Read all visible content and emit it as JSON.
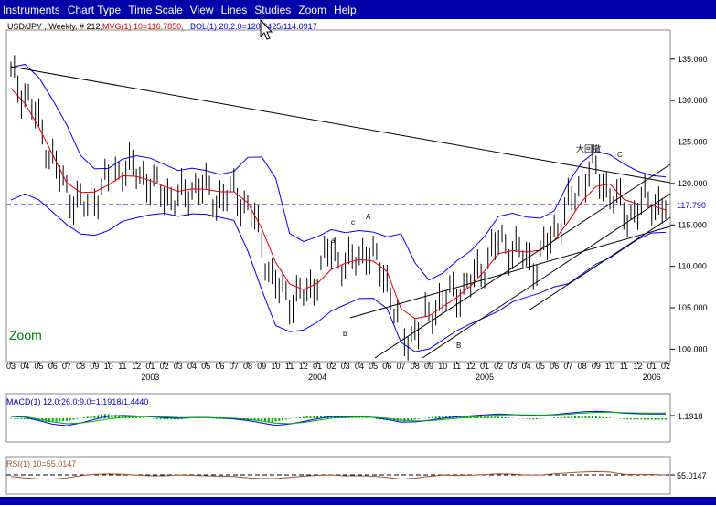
{
  "menu": [
    "Instruments",
    "Chart Type",
    "Time Scale",
    "View",
    "Lines",
    "Studies",
    "Zoom",
    "Help"
  ],
  "colors": {
    "menu_bg": "#0000a8",
    "price": "#000000",
    "mvg": "#e00000",
    "bollinger": "#0000ff",
    "macd_line": "#0000ff",
    "signal_line": "#00aa00",
    "histogram": "#00aa00",
    "rsi": "#a0522d",
    "zoom_label": "#008000",
    "reference_line": "#0000ff"
  },
  "price_header": {
    "symbol": "USD/JPY , Weekly, # 212,",
    "mvg": "MVG(1) 10=116.7850,",
    "bol": "BOL(1) 20,2.0=120.8425/114.0917"
  },
  "zoom_label": "Zoom",
  "cursor_icon": "arrow-pointer-icon",
  "price_axis_labels": [
    "135.000",
    "130.000",
    "125.000",
    "120.000",
    "115.000",
    "110.000",
    "105.000",
    "100.000"
  ],
  "current_price_label": "117.790",
  "wave_labels": [
    "a",
    "b",
    "c",
    "A",
    "B",
    "C",
    "大回撤"
  ],
  "month_labels": [
    "03",
    "04",
    "05",
    "06",
    "07",
    "08",
    "09",
    "10",
    "11",
    "12",
    "01",
    "02",
    "03",
    "04",
    "05",
    "06",
    "07",
    "08",
    "09",
    "10",
    "11",
    "12",
    "01",
    "02",
    "03",
    "04",
    "05",
    "06",
    "07",
    "08",
    "09",
    "10",
    "11",
    "12",
    "01",
    "02",
    "03",
    "04",
    "05",
    "06",
    "07",
    "08",
    "09",
    "10",
    "11",
    "12",
    "01",
    "02"
  ],
  "year_labels": [
    "2003",
    "2004",
    "2005",
    "2006"
  ],
  "macd_header": "MACD(1) 12.0;26.0;9.0=1.1918/1.4440",
  "macd_value_label": "1.1918",
  "rsi_header": "RSI(1) 10=55.0147",
  "rsi_value_label": "55.0147",
  "chart_data": [
    {
      "type": "ohlc",
      "title": "USD/JPY , Weekly, # 212,",
      "ylim": [
        98.5,
        138.5
      ],
      "y_ticks": [
        100,
        105,
        110,
        115,
        120,
        125,
        130,
        135
      ],
      "current_price": 117.79,
      "x_start": "2003-03",
      "x_end": "2006-02",
      "series": [
        {
          "name": "Price",
          "x": [
            "2003-03",
            "2003-04",
            "2003-05",
            "2003-06",
            "2003-07",
            "2003-08",
            "2003-09",
            "2003-10",
            "2003-11",
            "2003-12",
            "2004-01",
            "2004-02",
            "2004-03",
            "2004-04",
            "2004-05",
            "2004-06",
            "2004-07",
            "2004-08",
            "2004-09",
            "2004-10",
            "2004-11",
            "2004-12",
            "2005-01",
            "2005-02",
            "2005-03",
            "2005-04",
            "2005-05",
            "2005-06",
            "2005-07",
            "2005-08",
            "2005-09",
            "2005-10",
            "2005-11",
            "2005-12",
            "2006-01",
            "2006-02"
          ],
          "values": [
            133,
            130,
            124,
            119,
            117,
            120,
            122,
            121,
            119,
            118,
            120,
            118,
            119,
            116,
            108,
            106,
            107,
            112,
            110,
            112,
            109,
            101,
            103,
            106,
            107,
            109,
            113,
            112,
            110,
            114,
            118,
            122,
            119,
            116,
            118,
            117
          ]
        },
        {
          "name": "MVG(1) 10",
          "values": [
            131.5,
            129,
            124.5,
            120,
            118.5,
            119.5,
            121,
            120.8,
            119.8,
            119,
            119.5,
            119,
            119,
            117,
            111,
            107.5,
            107,
            109.5,
            110.5,
            111,
            110,
            104,
            103.5,
            105,
            106.5,
            108.5,
            111.5,
            112,
            111.5,
            113,
            116,
            119.5,
            120,
            117.5,
            117.5,
            116.8
          ]
        },
        {
          "name": "BOL upper",
          "values": [
            134,
            134.5,
            131,
            127,
            122,
            121.5,
            123,
            123.5,
            122.5,
            121.5,
            122,
            121,
            121.5,
            124,
            122,
            113,
            113,
            114.5,
            114,
            114.5,
            113.5,
            114,
            108,
            109,
            111,
            112.5,
            116,
            116.5,
            115.5,
            116.5,
            121,
            124,
            123.5,
            122,
            121,
            120.8
          ]
        },
        {
          "name": "BOL lower",
          "values": [
            118,
            119,
            117,
            115,
            113.5,
            114,
            115.5,
            116,
            116.5,
            116,
            116.5,
            116,
            115.5,
            110,
            103,
            102,
            102.5,
            104.5,
            105.5,
            106.5,
            105.5,
            100,
            99.5,
            101,
            102.5,
            103.5,
            104.5,
            106,
            106.5,
            107.5,
            108,
            110,
            111,
            112.5,
            114,
            114.1
          ]
        }
      ]
    },
    {
      "type": "bar",
      "title": "MACD(1) 12.0;26.0;9.0=1.1918/1.4440",
      "series": [
        {
          "name": "MACD",
          "values": [
            0.5,
            0.2,
            -1.5,
            -2.0,
            -1.0,
            0.5,
            0.8,
            0.6,
            0.2,
            0.0,
            0.3,
            0.1,
            -0.2,
            -0.8,
            -2.0,
            -1.5,
            -0.5,
            0.5,
            0.4,
            0.5,
            -0.2,
            -1.2,
            -0.8,
            0.0,
            0.5,
            0.8,
            1.2,
            1.0,
            0.7,
            1.0,
            1.5,
            2.0,
            1.8,
            1.3,
            1.2,
            1.19
          ]
        },
        {
          "name": "Signal",
          "values": [
            0.6,
            0.4,
            -0.8,
            -1.5,
            -1.2,
            -0.3,
            0.3,
            0.5,
            0.4,
            0.2,
            0.2,
            0.2,
            0.0,
            -0.4,
            -1.3,
            -1.5,
            -0.9,
            0.0,
            0.3,
            0.4,
            0.1,
            -0.6,
            -0.8,
            -0.4,
            0.1,
            0.5,
            0.9,
            1.0,
            0.9,
            0.9,
            1.2,
            1.6,
            1.7,
            1.5,
            1.45,
            1.444
          ]
        }
      ]
    },
    {
      "type": "line",
      "title": "RSI(1) 10=55.0147",
      "reference": 55.0147,
      "series": [
        {
          "name": "RSI",
          "values": [
            48,
            40,
            35,
            42,
            55,
            60,
            58,
            52,
            50,
            55,
            52,
            50,
            48,
            40,
            38,
            45,
            52,
            55,
            50,
            52,
            45,
            35,
            45,
            55,
            52,
            55,
            60,
            58,
            52,
            60,
            65,
            70,
            68,
            55,
            58,
            55
          ]
        }
      ]
    }
  ]
}
